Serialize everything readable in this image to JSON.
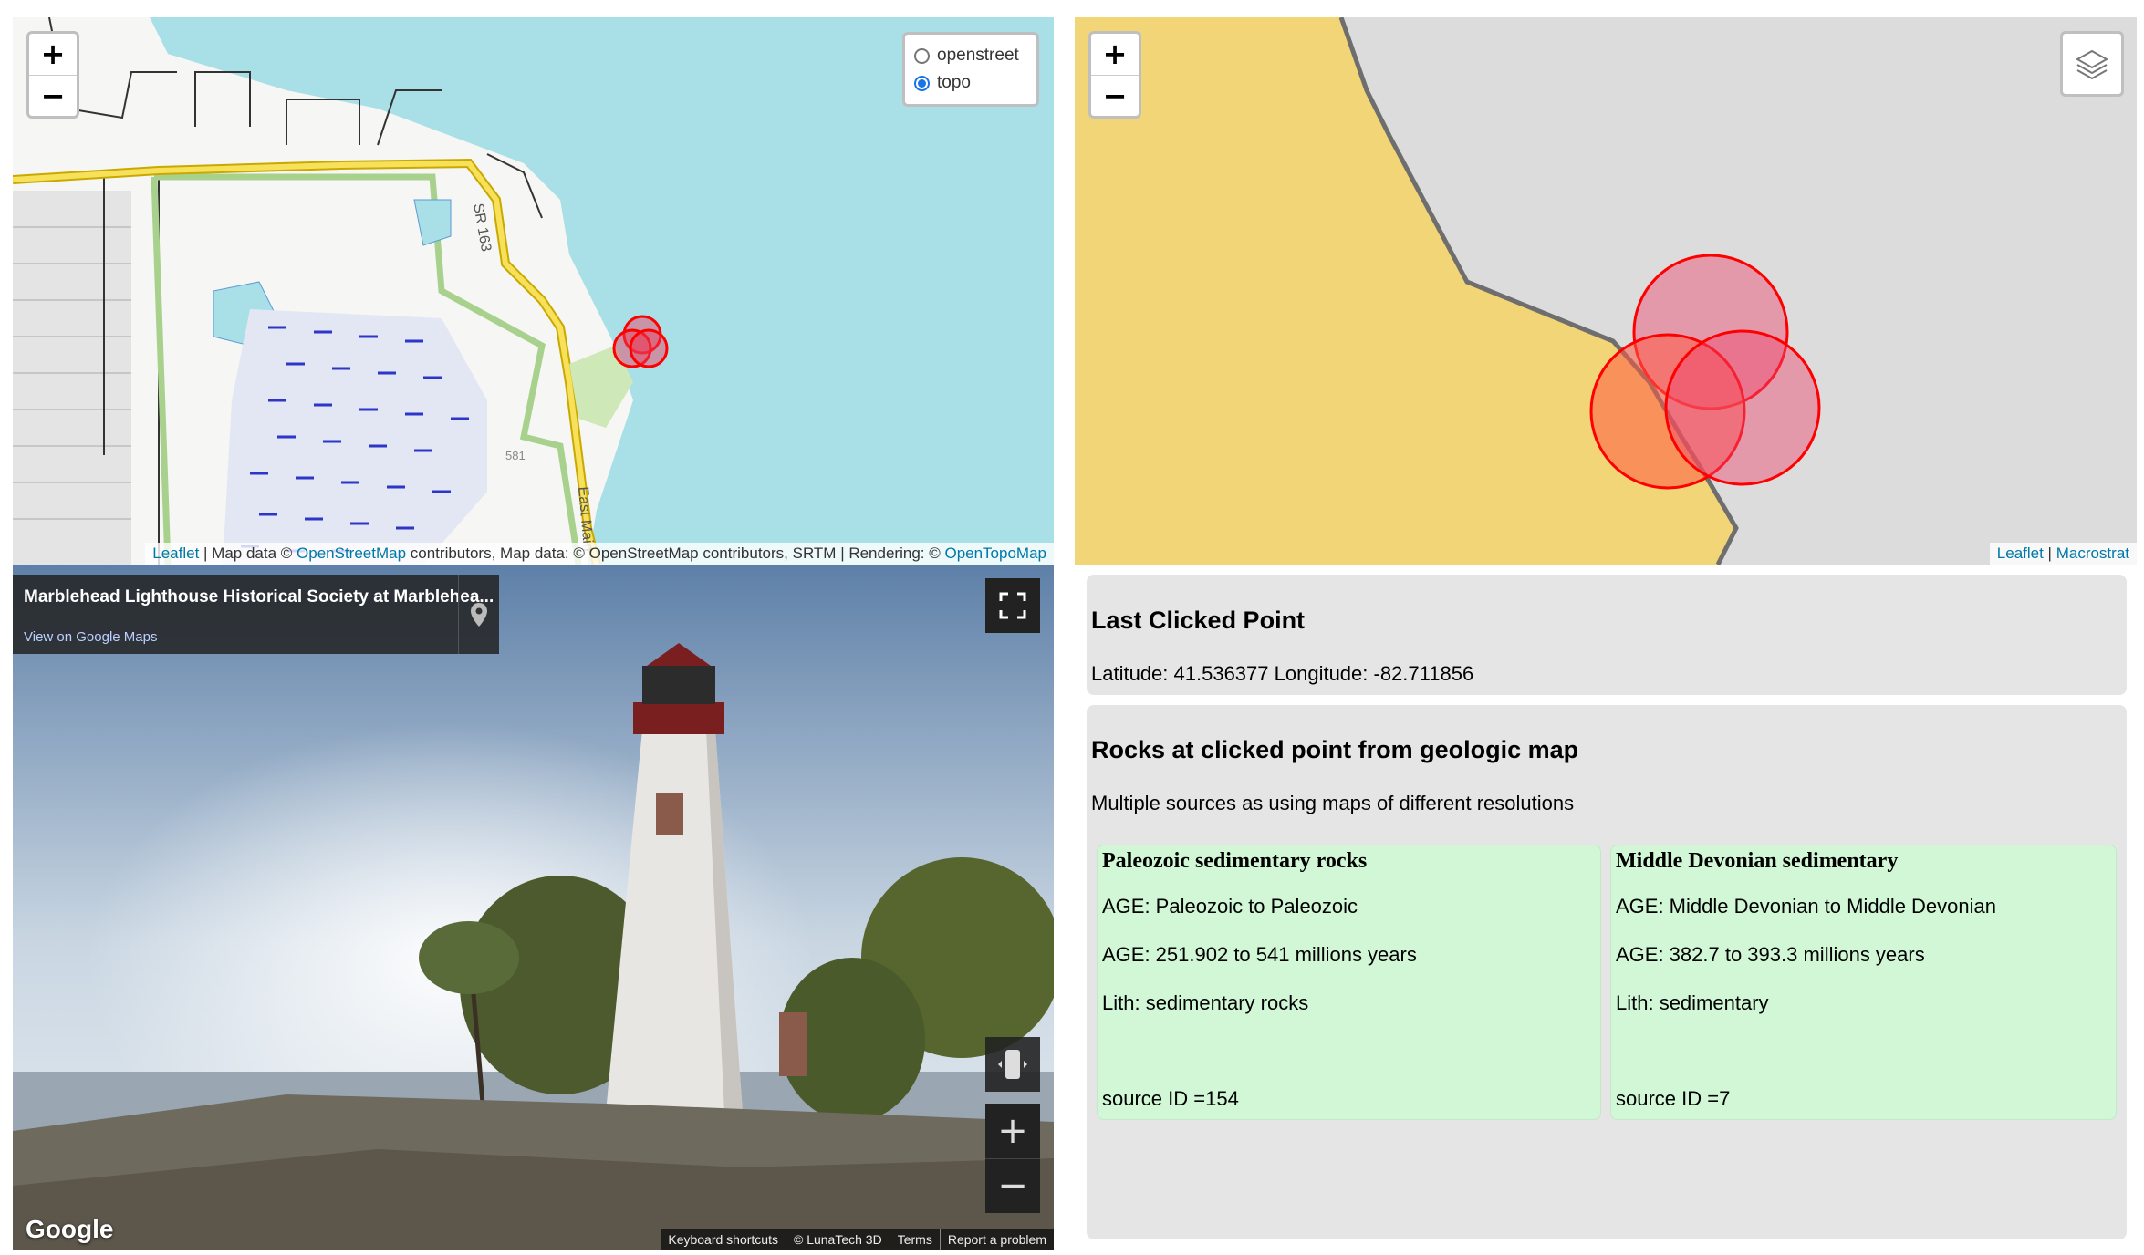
{
  "topo_map": {
    "zoom_in": "+",
    "zoom_out": "−",
    "layers": [
      {
        "label": "openstreet",
        "selected": false
      },
      {
        "label": "topo",
        "selected": true
      }
    ],
    "road_label_1": "SR 163",
    "road_label_2": "East Main",
    "elevation_label": "581",
    "attribution": {
      "leaflet": "Leaflet",
      "text1": " | Map data © ",
      "osm": "OpenStreetMap",
      "text2": " contributors, Map data: © OpenStreetMap contributors, SRTM | Rendering: © ",
      "otm": "OpenTopoMap"
    }
  },
  "geo_map": {
    "zoom_in": "+",
    "zoom_out": "−",
    "attribution": {
      "leaflet": "Leaflet",
      "sep": " | ",
      "macrostrat": "Macrostrat"
    }
  },
  "street_view": {
    "title": "Marblehead Lighthouse Historical Society at Marblehea...",
    "link": "View on Google Maps",
    "logo": "Google",
    "footer": [
      "Keyboard shortcuts",
      "© LunaTech 3D",
      "Terms",
      "Report a problem"
    ],
    "zoom_in": "+",
    "zoom_out": "−"
  },
  "last_clicked": {
    "heading": "Last Clicked Point",
    "coords": "Latitude: 41.536377 Longitude: -82.711856"
  },
  "rocks": {
    "heading": "Rocks at clicked point from geologic map",
    "subtitle": "Multiple sources as using maps of different resolutions",
    "units": [
      {
        "name": "Paleozoic sedimentary rocks",
        "age1": "AGE: Paleozoic to Paleozoic",
        "age2": "AGE: 251.902 to 541 millions years",
        "lith": "Lith: sedimentary rocks",
        "source": "source ID =154"
      },
      {
        "name": "Middle Devonian sedimentary",
        "age1": "AGE: Middle Devonian to Middle Devonian",
        "age2": "AGE: 382.7 to 393.3 millions years",
        "lith": "Lith: sedimentary",
        "source": "source ID =7"
      }
    ]
  },
  "colors": {
    "water": "#a9dfe6",
    "geo_unit_yellow": "#f2d577",
    "geo_unit_grey": "#dcdcdc",
    "marker_red": "#ff0000",
    "rock_card": "#d1f7d6",
    "info_card": "#e5e5e5"
  }
}
